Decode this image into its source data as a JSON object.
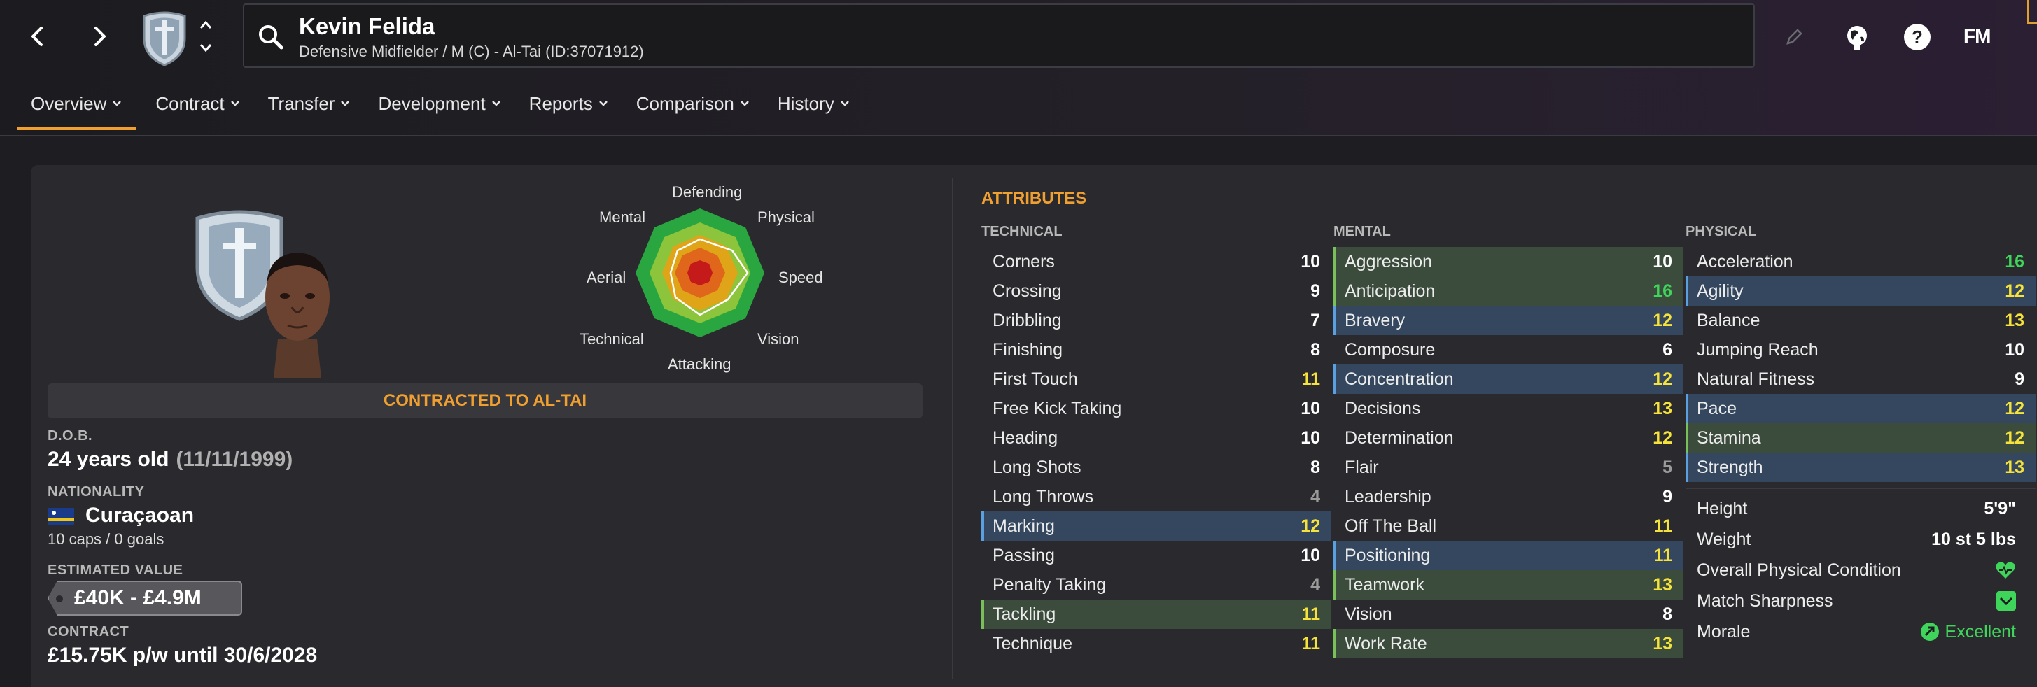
{
  "header": {
    "player_name": "Kevin Felida",
    "player_sub": "Defensive Midfielder / M (C) - Al-Tai (ID:37071912)",
    "fm_logo": "FM",
    "icons": [
      "back-icon",
      "forward-icon",
      "club-crest-icon",
      "up-down-icon",
      "search-icon",
      "edit-pencil-icon",
      "globe-icon",
      "help-icon"
    ]
  },
  "tabs": [
    {
      "label": "Overview"
    },
    {
      "label": "Contract"
    },
    {
      "label": "Transfer"
    },
    {
      "label": "Development"
    },
    {
      "label": "Reports"
    },
    {
      "label": "Comparison"
    },
    {
      "label": "History"
    }
  ],
  "radar": {
    "labels": {
      "defending": "Defending",
      "physical": "Physical",
      "speed": "Speed",
      "vision": "Vision",
      "attacking": "Attacking",
      "technical": "Technical",
      "aerial": "Aerial",
      "mental": "Mental"
    }
  },
  "profile": {
    "contracted_to": "CONTRACTED TO AL-TAI",
    "dob_label": "D.O.B.",
    "age": "24 years old",
    "dob": "(11/11/1999)",
    "nationality_label": "NATIONALITY",
    "nationality": "Curaçaoan",
    "caps": "10 caps / 0 goals",
    "value_label": "ESTIMATED VALUE",
    "value": "£40K - £4.9M",
    "contract_label": "CONTRACT",
    "contract": "£15.75K p/w until 30/6/2028"
  },
  "attributes": {
    "title": "ATTRIBUTES",
    "technical_head": "TECHNICAL",
    "mental_head": "MENTAL",
    "physical_head": "PHYSICAL",
    "technical": [
      {
        "name": "Corners",
        "value": "10",
        "tone": "white",
        "hl": ""
      },
      {
        "name": "Crossing",
        "value": "9",
        "tone": "white",
        "hl": ""
      },
      {
        "name": "Dribbling",
        "value": "7",
        "tone": "white",
        "hl": ""
      },
      {
        "name": "Finishing",
        "value": "8",
        "tone": "white",
        "hl": ""
      },
      {
        "name": "First Touch",
        "value": "11",
        "tone": "yellow",
        "hl": ""
      },
      {
        "name": "Free Kick Taking",
        "value": "10",
        "tone": "white",
        "hl": ""
      },
      {
        "name": "Heading",
        "value": "10",
        "tone": "white",
        "hl": ""
      },
      {
        "name": "Long Shots",
        "value": "8",
        "tone": "white",
        "hl": ""
      },
      {
        "name": "Long Throws",
        "value": "4",
        "tone": "grey",
        "hl": ""
      },
      {
        "name": "Marking",
        "value": "12",
        "tone": "yellow",
        "hl": "blue"
      },
      {
        "name": "Passing",
        "value": "10",
        "tone": "white",
        "hl": ""
      },
      {
        "name": "Penalty Taking",
        "value": "4",
        "tone": "grey",
        "hl": ""
      },
      {
        "name": "Tackling",
        "value": "11",
        "tone": "yellow",
        "hl": "green"
      },
      {
        "name": "Technique",
        "value": "11",
        "tone": "yellow",
        "hl": ""
      }
    ],
    "mental": [
      {
        "name": "Aggression",
        "value": "10",
        "tone": "white",
        "hl": "green"
      },
      {
        "name": "Anticipation",
        "value": "16",
        "tone": "green",
        "hl": "green"
      },
      {
        "name": "Bravery",
        "value": "12",
        "tone": "yellow",
        "hl": "blue"
      },
      {
        "name": "Composure",
        "value": "6",
        "tone": "white",
        "hl": ""
      },
      {
        "name": "Concentration",
        "value": "12",
        "tone": "yellow",
        "hl": "blue"
      },
      {
        "name": "Decisions",
        "value": "13",
        "tone": "yellow",
        "hl": ""
      },
      {
        "name": "Determination",
        "value": "12",
        "tone": "yellow",
        "hl": ""
      },
      {
        "name": "Flair",
        "value": "5",
        "tone": "grey",
        "hl": ""
      },
      {
        "name": "Leadership",
        "value": "9",
        "tone": "white",
        "hl": ""
      },
      {
        "name": "Off The Ball",
        "value": "11",
        "tone": "yellow",
        "hl": ""
      },
      {
        "name": "Positioning",
        "value": "11",
        "tone": "yellow",
        "hl": "blue"
      },
      {
        "name": "Teamwork",
        "value": "13",
        "tone": "yellow",
        "hl": "green"
      },
      {
        "name": "Vision",
        "value": "8",
        "tone": "white",
        "hl": ""
      },
      {
        "name": "Work Rate",
        "value": "13",
        "tone": "yellow",
        "hl": "green"
      }
    ],
    "physical": [
      {
        "name": "Acceleration",
        "value": "16",
        "tone": "green",
        "hl": ""
      },
      {
        "name": "Agility",
        "value": "12",
        "tone": "yellow",
        "hl": "blue"
      },
      {
        "name": "Balance",
        "value": "13",
        "tone": "yellow",
        "hl": ""
      },
      {
        "name": "Jumping Reach",
        "value": "10",
        "tone": "white",
        "hl": ""
      },
      {
        "name": "Natural Fitness",
        "value": "9",
        "tone": "white",
        "hl": ""
      },
      {
        "name": "Pace",
        "value": "12",
        "tone": "yellow",
        "hl": "blue"
      },
      {
        "name": "Stamina",
        "value": "12",
        "tone": "yellow",
        "hl": "green"
      },
      {
        "name": "Strength",
        "value": "13",
        "tone": "yellow",
        "hl": "blue"
      }
    ]
  },
  "physical_info": {
    "height_label": "Height",
    "height": "5'9\"",
    "weight_label": "Weight",
    "weight": "10 st 5 lbs",
    "condition_label": "Overall Physical Condition",
    "sharpness_label": "Match Sharpness",
    "morale_label": "Morale",
    "morale": "Excellent"
  },
  "colors": {
    "accent": "#f0a030",
    "attr_green": "#3fd45a",
    "attr_yellow": "#f5e23a",
    "highlight_blue": "#34475e",
    "highlight_green": "#3c4c3c"
  }
}
